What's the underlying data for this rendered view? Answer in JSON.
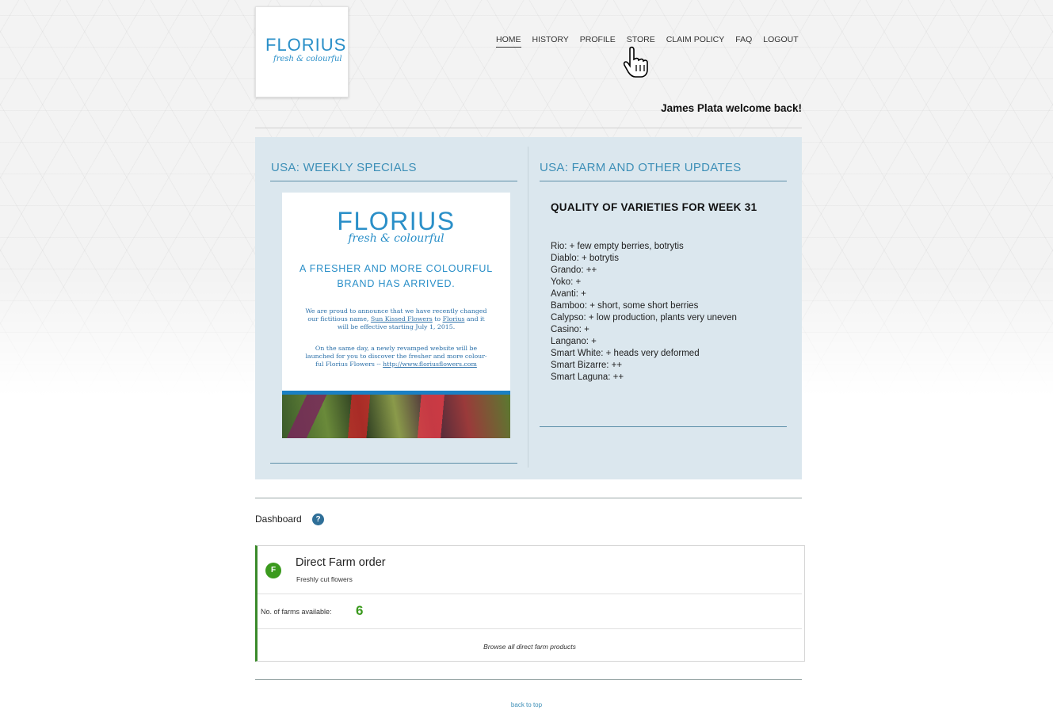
{
  "brand": {
    "name": "FLORIUS",
    "tagline": "fresh & colourful"
  },
  "nav": {
    "items": [
      "HOME",
      "HISTORY",
      "PROFILE",
      "STORE",
      "CLAIM POLICY",
      "FAQ",
      "LOGOUT"
    ],
    "active": "HOME"
  },
  "welcome": "James Plata welcome back!",
  "specials": {
    "title": "USA: WEEKLY SPECIALS",
    "flyer": {
      "logo": "FLORIUS",
      "tagline": "fresh & colourful",
      "headline_1": "A FRESHER AND MORE COLOURFUL",
      "headline_2": "BRAND HAS ARRIVED.",
      "p1_a": "We are proud to announce that we have recently changed",
      "p1_b": "our fictitious name,",
      "p1_link1": "Sun Kissed Flowers",
      "p1_c": "to",
      "p1_link2": "Florius",
      "p1_d": "and it",
      "p1_e": "will be effective starting July 1, 2015.",
      "p2_a": "On the same day, a newly revamped website will be",
      "p2_b": "launched for you to discover the fresher and more colour-",
      "p2_c": "ful Florius Flowers --",
      "p2_link": "http://www.floriusflowers.com"
    }
  },
  "updates": {
    "title": "USA: FARM AND OTHER UPDATES",
    "heading": "QUALITY OF VARIETIES FOR WEEK 31",
    "varieties": [
      "Rio: + few empty berries, botrytis",
      "Diablo: + botrytis",
      "Grando: ++",
      "Yoko: +",
      "Avanti: +",
      "Bamboo: + short, some short berries",
      "Calypso: + low production, plants very uneven",
      "Casino: +",
      "Langano: +",
      "Smart White: + heads very deformed",
      "Smart Bizarre: ++",
      "Smart Laguna: ++"
    ]
  },
  "dashboard": {
    "label": "Dashboard",
    "help_icon": "?",
    "card": {
      "badge": "F",
      "title": "Direct Farm order",
      "subtitle": "Freshly cut flowers",
      "farms_label": "No. of farms available:",
      "farms_count": "6",
      "browse": "Browse all direct farm products"
    }
  },
  "footer": {
    "back_to_top": "back to top"
  },
  "colors": {
    "brand_blue": "#2a8fc8",
    "panel_bg": "#dbe7ee",
    "accent_green": "#3b9a1e"
  }
}
